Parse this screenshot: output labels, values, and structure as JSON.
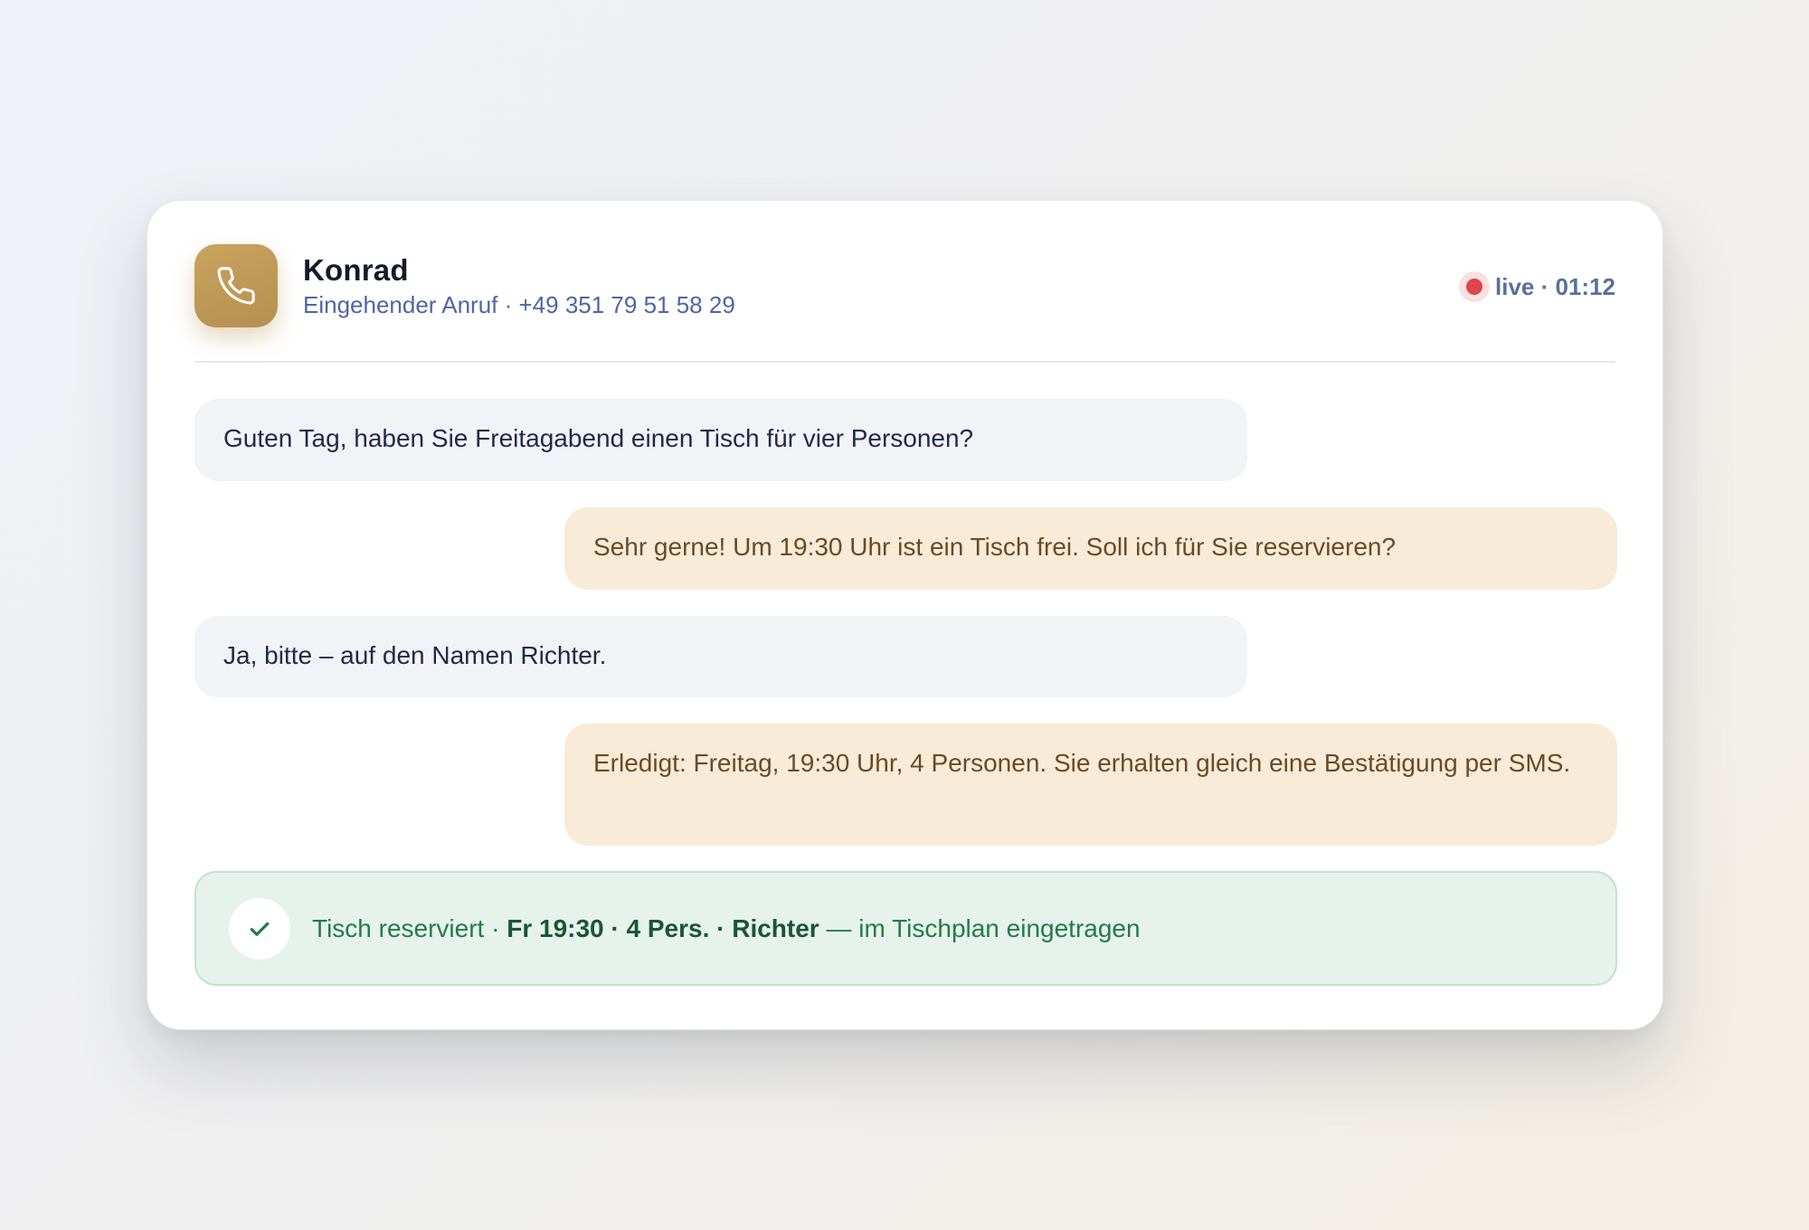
{
  "call": {
    "caller_name": "Konrad",
    "caller_subtitle": "Eingehender Anruf · +49 351 79 51 58 29",
    "status": "live · 01:12",
    "icon": "phone-icon"
  },
  "messages": [
    {
      "role": "caller",
      "text": "Guten Tag, haben Sie Freitagabend einen Tisch für vier Personen?"
    },
    {
      "role": "assistant",
      "text": "Sehr gerne! Um 19:30 Uhr ist ein Tisch frei. Soll ich für Sie reservieren?"
    },
    {
      "role": "caller",
      "text": "Ja, bitte – auf den Namen Richter."
    },
    {
      "role": "assistant",
      "text": "Erledigt: Freitag, 19:30 Uhr, 4 Personen. Sie erhalten gleich eine Bestätigung per SMS."
    }
  ],
  "confirmation": {
    "icon": "check-icon",
    "prefix": "Tisch reserviert · ",
    "details": "Fr 19:30 · 4 Pers. · Richter",
    "suffix": " — im Tischplan eingetragen"
  },
  "colors": {
    "accent": "#c9a45e",
    "live_dot": "#e0444b",
    "confirm_text": "#257a4a",
    "caller_bubble": "#f2f3f7",
    "assistant_bubble": "#f8ebd8"
  }
}
